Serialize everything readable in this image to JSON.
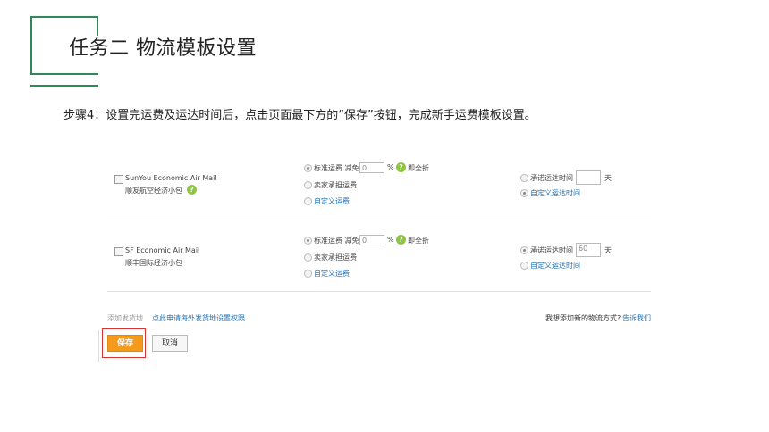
{
  "slide": {
    "title": "任务二 物流模板设置",
    "step": "步骤4：设置完运费及运达时间后，点击页面最下方的“保存”按钮，完成新手运费模板设置。"
  },
  "rows": [
    {
      "name_en": "SunYou Economic Air Mail",
      "name_cn": "顺友航空经济小包",
      "standard_label": "标准运费 减免",
      "discount_value": "0",
      "percent_suffix": "%",
      "full_discount": "即全折",
      "seller_pays": "卖家承担运费",
      "custom_fee": "自定义运费",
      "promise_time": "承诺运达时间",
      "promise_value": "",
      "days": "天",
      "custom_time": "自定义运达时间"
    },
    {
      "name_en": "SF Economic Air Mail",
      "name_cn": "顺丰国际经济小包",
      "standard_label": "标准运费 减免",
      "discount_value": "0",
      "percent_suffix": "%",
      "full_discount": "即全折",
      "seller_pays": "卖家承担运费",
      "custom_fee": "自定义运费",
      "promise_time": "承诺运达时间",
      "promise_value": "60",
      "days": "天",
      "custom_time": "自定义运达时间"
    }
  ],
  "footer": {
    "add_origin": "添加发货地",
    "apply_link": "点此申请海外发货地设置权限",
    "suggest_text": "我想添加新的物流方式?",
    "suggest_link": "告诉我们"
  },
  "buttons": {
    "save": "保存",
    "cancel": "取消"
  },
  "colors": {
    "accent_green": "#2e8b57",
    "save_orange": "#f49a1d",
    "link_blue": "#1f6fb5",
    "highlight_red": "#dd3333"
  }
}
